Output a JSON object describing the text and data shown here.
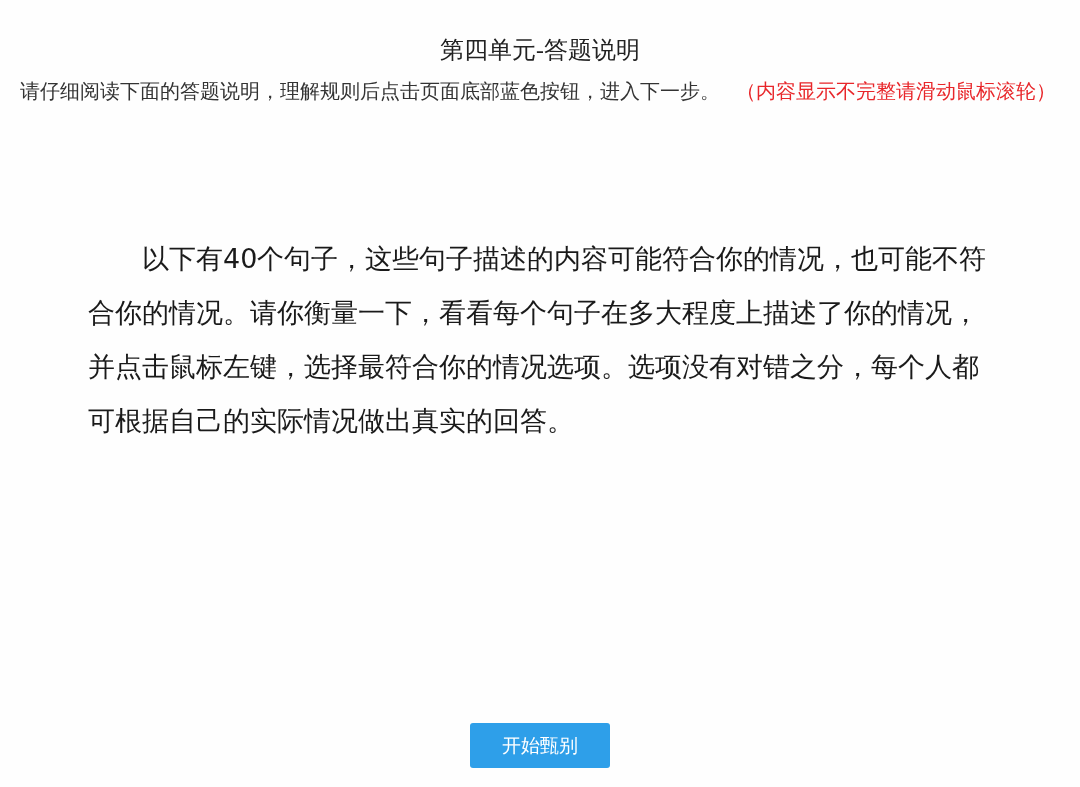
{
  "title": "第四单元-答题说明",
  "instruction": {
    "text": "请仔细阅读下面的答题说明，理解规则后点击页面底部蓝色按钮，进入下一步。",
    "note": "（内容显示不完整请滑动鼠标滚轮）"
  },
  "body": "以下有40个句子，这些句子描述的内容可能符合你的情况，也可能不符合你的情况。请你衡量一下，看看每个句子在多大程度上描述了你的情况，并点击鼠标左键，选择最符合你的情况选项。选项没有对错之分，每个人都可根据自己的实际情况做出真实的回答。",
  "button": {
    "label": "开始甄别"
  }
}
